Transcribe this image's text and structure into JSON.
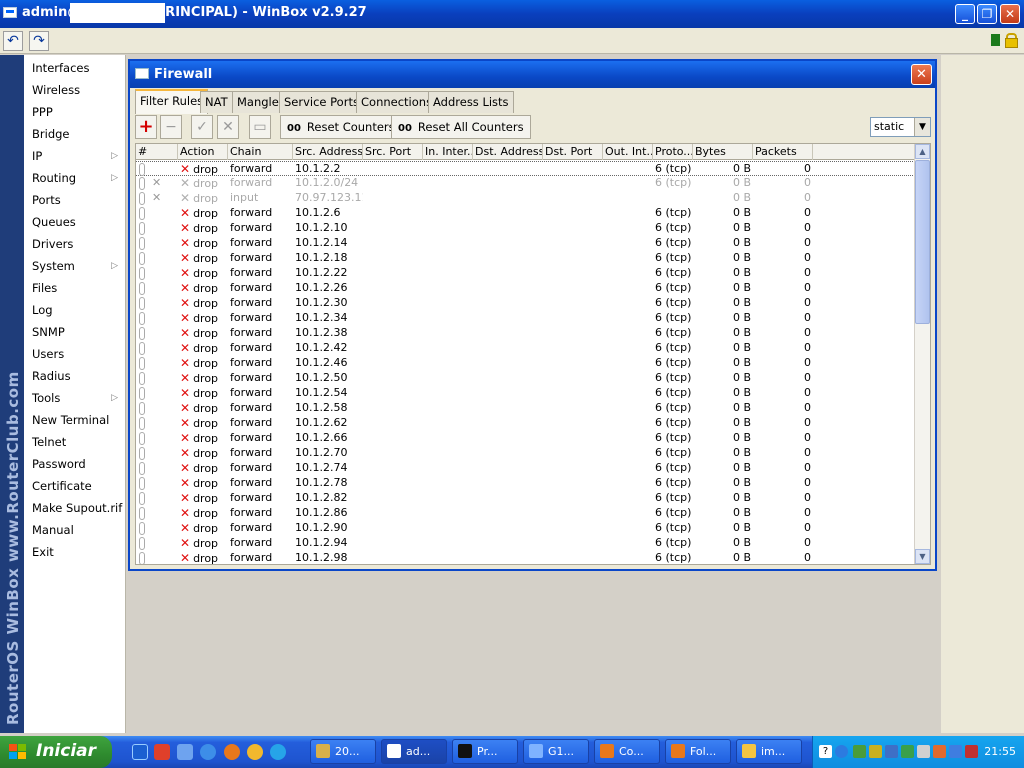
{
  "window": {
    "title": "admin@          (AP PRINCIPAL) - WinBox v2.9.27"
  },
  "brand": {
    "text": "RouterOS WinBox   www.RouterClub.com"
  },
  "menu": {
    "items": [
      {
        "label": "Interfaces",
        "arrow": false
      },
      {
        "label": "Wireless",
        "arrow": false
      },
      {
        "label": "PPP",
        "arrow": false
      },
      {
        "label": "Bridge",
        "arrow": false
      },
      {
        "label": "IP",
        "arrow": true
      },
      {
        "label": "Routing",
        "arrow": true
      },
      {
        "label": "Ports",
        "arrow": false
      },
      {
        "label": "Queues",
        "arrow": false
      },
      {
        "label": "Drivers",
        "arrow": false
      },
      {
        "label": "System",
        "arrow": true
      },
      {
        "label": "Files",
        "arrow": false
      },
      {
        "label": "Log",
        "arrow": false
      },
      {
        "label": "SNMP",
        "arrow": false
      },
      {
        "label": "Users",
        "arrow": false
      },
      {
        "label": "Radius",
        "arrow": false
      },
      {
        "label": "Tools",
        "arrow": true
      },
      {
        "label": "New Terminal",
        "arrow": false
      },
      {
        "label": "Telnet",
        "arrow": false
      },
      {
        "label": "Password",
        "arrow": false
      },
      {
        "label": "Certificate",
        "arrow": false
      },
      {
        "label": "Make Supout.rif",
        "arrow": false
      },
      {
        "label": "Manual",
        "arrow": false
      },
      {
        "label": "Exit",
        "arrow": false
      }
    ]
  },
  "firewall": {
    "title": "Firewall",
    "tabs": [
      "Filter Rules",
      "NAT",
      "Mangle",
      "Service Ports",
      "Connections",
      "Address Lists"
    ],
    "active_tab": 0,
    "reset_counters_label": "Reset Counters",
    "reset_all_counters_label": "Reset All Counters",
    "counter_icon": "00",
    "filter_value": "static",
    "columns": [
      "#",
      "Action",
      "Chain",
      "Src. Address",
      "Src. Port",
      "In. Inter...",
      "Dst. Address",
      "Dst. Port",
      "Out. Int...",
      "Proto...",
      "Bytes",
      "Packets"
    ],
    "rows": [
      {
        "action": "drop",
        "chain": "forward",
        "src": "10.1.2.2",
        "proto": "6 (tcp)",
        "bytes": "0 B",
        "packets": "0",
        "disabled": false,
        "selected": true
      },
      {
        "action": "drop",
        "chain": "forward",
        "src": "10.1.2.0/24",
        "proto": "6 (tcp)",
        "bytes": "0 B",
        "packets": "0",
        "disabled": true
      },
      {
        "action": "drop",
        "chain": "input",
        "src": "70.97.123.11",
        "proto": "",
        "bytes": "0 B",
        "packets": "0",
        "disabled": true
      },
      {
        "action": "drop",
        "chain": "forward",
        "src": "10.1.2.6",
        "proto": "6 (tcp)",
        "bytes": "0 B",
        "packets": "0",
        "disabled": false
      },
      {
        "action": "drop",
        "chain": "forward",
        "src": "10.1.2.10",
        "proto": "6 (tcp)",
        "bytes": "0 B",
        "packets": "0",
        "disabled": false
      },
      {
        "action": "drop",
        "chain": "forward",
        "src": "10.1.2.14",
        "proto": "6 (tcp)",
        "bytes": "0 B",
        "packets": "0",
        "disabled": false
      },
      {
        "action": "drop",
        "chain": "forward",
        "src": "10.1.2.18",
        "proto": "6 (tcp)",
        "bytes": "0 B",
        "packets": "0",
        "disabled": false
      },
      {
        "action": "drop",
        "chain": "forward",
        "src": "10.1.2.22",
        "proto": "6 (tcp)",
        "bytes": "0 B",
        "packets": "0",
        "disabled": false
      },
      {
        "action": "drop",
        "chain": "forward",
        "src": "10.1.2.26",
        "proto": "6 (tcp)",
        "bytes": "0 B",
        "packets": "0",
        "disabled": false
      },
      {
        "action": "drop",
        "chain": "forward",
        "src": "10.1.2.30",
        "proto": "6 (tcp)",
        "bytes": "0 B",
        "packets": "0",
        "disabled": false
      },
      {
        "action": "drop",
        "chain": "forward",
        "src": "10.1.2.34",
        "proto": "6 (tcp)",
        "bytes": "0 B",
        "packets": "0",
        "disabled": false
      },
      {
        "action": "drop",
        "chain": "forward",
        "src": "10.1.2.38",
        "proto": "6 (tcp)",
        "bytes": "0 B",
        "packets": "0",
        "disabled": false
      },
      {
        "action": "drop",
        "chain": "forward",
        "src": "10.1.2.42",
        "proto": "6 (tcp)",
        "bytes": "0 B",
        "packets": "0",
        "disabled": false
      },
      {
        "action": "drop",
        "chain": "forward",
        "src": "10.1.2.46",
        "proto": "6 (tcp)",
        "bytes": "0 B",
        "packets": "0",
        "disabled": false
      },
      {
        "action": "drop",
        "chain": "forward",
        "src": "10.1.2.50",
        "proto": "6 (tcp)",
        "bytes": "0 B",
        "packets": "0",
        "disabled": false
      },
      {
        "action": "drop",
        "chain": "forward",
        "src": "10.1.2.54",
        "proto": "6 (tcp)",
        "bytes": "0 B",
        "packets": "0",
        "disabled": false
      },
      {
        "action": "drop",
        "chain": "forward",
        "src": "10.1.2.58",
        "proto": "6 (tcp)",
        "bytes": "0 B",
        "packets": "0",
        "disabled": false
      },
      {
        "action": "drop",
        "chain": "forward",
        "src": "10.1.2.62",
        "proto": "6 (tcp)",
        "bytes": "0 B",
        "packets": "0",
        "disabled": false
      },
      {
        "action": "drop",
        "chain": "forward",
        "src": "10.1.2.66",
        "proto": "6 (tcp)",
        "bytes": "0 B",
        "packets": "0",
        "disabled": false
      },
      {
        "action": "drop",
        "chain": "forward",
        "src": "10.1.2.70",
        "proto": "6 (tcp)",
        "bytes": "0 B",
        "packets": "0",
        "disabled": false
      },
      {
        "action": "drop",
        "chain": "forward",
        "src": "10.1.2.74",
        "proto": "6 (tcp)",
        "bytes": "0 B",
        "packets": "0",
        "disabled": false
      },
      {
        "action": "drop",
        "chain": "forward",
        "src": "10.1.2.78",
        "proto": "6 (tcp)",
        "bytes": "0 B",
        "packets": "0",
        "disabled": false
      },
      {
        "action": "drop",
        "chain": "forward",
        "src": "10.1.2.82",
        "proto": "6 (tcp)",
        "bytes": "0 B",
        "packets": "0",
        "disabled": false
      },
      {
        "action": "drop",
        "chain": "forward",
        "src": "10.1.2.86",
        "proto": "6 (tcp)",
        "bytes": "0 B",
        "packets": "0",
        "disabled": false
      },
      {
        "action": "drop",
        "chain": "forward",
        "src": "10.1.2.90",
        "proto": "6 (tcp)",
        "bytes": "0 B",
        "packets": "0",
        "disabled": false
      },
      {
        "action": "drop",
        "chain": "forward",
        "src": "10.1.2.94",
        "proto": "6 (tcp)",
        "bytes": "0 B",
        "packets": "0",
        "disabled": false
      },
      {
        "action": "drop",
        "chain": "forward",
        "src": "10.1.2.98",
        "proto": "6 (tcp)",
        "bytes": "0 B",
        "packets": "0",
        "disabled": false
      }
    ]
  },
  "taskbar": {
    "start_label": "Iniciar",
    "tasks": [
      {
        "label": "20...",
        "icon": "network-icon"
      },
      {
        "label": "ad...",
        "icon": "winbox-icon",
        "active": true
      },
      {
        "label": "Pr...",
        "icon": "cmd-icon"
      },
      {
        "label": "G1...",
        "icon": "app-icon"
      },
      {
        "label": "Co...",
        "icon": "firefox-icon"
      },
      {
        "label": "Fol...",
        "icon": "firefox-icon"
      },
      {
        "label": "im...",
        "icon": "paint-icon"
      }
    ],
    "clock": "21:55"
  }
}
